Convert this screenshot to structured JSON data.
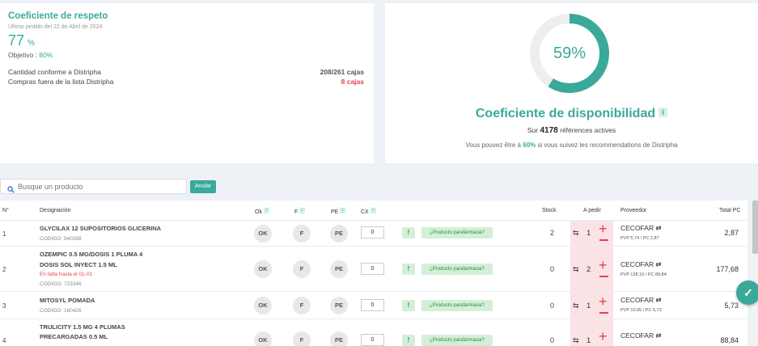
{
  "respeto": {
    "title": "Coeficiente de respeto",
    "subtitle": "Ultimo pedido del 22 de Abril de 2024",
    "value": "77",
    "unit": "%",
    "objective_label": "Objetivo : ",
    "objective_value": "80%",
    "rows": [
      {
        "label": "Cantidad conforme a Distripha",
        "value": "208/261 cajas",
        "color": "#555555"
      },
      {
        "label": "Compras fuera de la lista Distripha",
        "value": "8 cajas",
        "color": "#e0434e"
      }
    ]
  },
  "disponibilidad": {
    "percent_label": "59%",
    "percent": 0.59,
    "title": "Coeficiente de disponibilidad",
    "info_icon": "i",
    "sur_prefix": "Sur",
    "sur_count": "4178",
    "sur_suffix": "références actives",
    "rec_prefix": "Vous pouvez être à",
    "rec_value": "60%",
    "rec_suffix": "si vous suivez les recommendations de Distripha",
    "ring_color": "#3aa99a",
    "track_color": "#eeeeee"
  },
  "search": {
    "placeholder": "Busque un producto",
    "button_label": "Anular"
  },
  "table": {
    "headers": {
      "n": "N°",
      "designacion": "Designación",
      "ok": "Ok",
      "f": "F",
      "pe": "PE",
      "cx": "CX",
      "stock": "Stock",
      "a_pedir": "A pedir",
      "proveedor": "Proveedor",
      "total": "Total PC",
      "info": "i"
    },
    "badges": {
      "ok": "OK",
      "f": "F",
      "pe": "PE",
      "excl": "!",
      "para": "¿Producto parafarmacia?"
    },
    "rows": [
      {
        "n": "1",
        "name1": "GLYCILAX 12 SUPOSITORIOS GLICERINA",
        "name2": "",
        "warn": "",
        "code": "CODIGO: 940288",
        "cx": "0",
        "stock": "2",
        "qty": "1",
        "prov": "CECOFAR",
        "prov_sub": "PVP 5,74 / PC 2,87",
        "total": "2,87"
      },
      {
        "n": "2",
        "name1": "OZEMPIC 0.5 MG/DOSIS 1 PLUMA 4",
        "name2": "DOSIS SOL INYECT 1.5 ML",
        "warn": "En falta hasta el 01-01",
        "code": "CODIGO: 723346",
        "cx": "0",
        "stock": "0",
        "qty": "2",
        "prov": "CECOFAR",
        "prov_sub": "PVP 128,15 / PC 88,84",
        "total": "177,68"
      },
      {
        "n": "3",
        "name1": "MITOSYL POMADA",
        "name2": "",
        "warn": "",
        "code": "CODIGO: 160426",
        "cx": "0",
        "stock": "0",
        "qty": "1",
        "prov": "CECOFAR",
        "prov_sub": "PVP 10,95 / PC 5,73",
        "total": "5,73"
      },
      {
        "n": "4",
        "name1": "TRULICITY 1.5 MG 4 PLUMAS",
        "name2": "PRECARGADAS 0.5 ML",
        "warn": "",
        "code": "",
        "cx": "0",
        "stock": "0",
        "qty": "1",
        "prov": "CECOFAR",
        "prov_sub": "",
        "total": "88,84"
      }
    ]
  },
  "fab_icon": "check-icon"
}
